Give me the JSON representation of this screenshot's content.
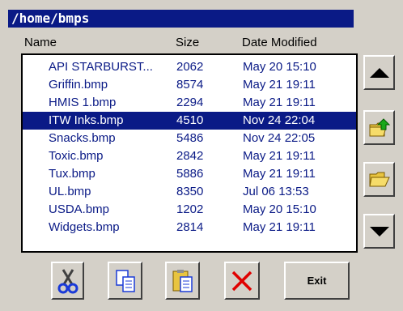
{
  "window": {
    "title": "/home/bmps"
  },
  "columns": {
    "name": "Name",
    "size": "Size",
    "date": "Date Modified"
  },
  "files": [
    {
      "name": "API STARBURST...",
      "size": "2062",
      "date": "May 20 15:10",
      "selected": false
    },
    {
      "name": "Griffin.bmp",
      "size": "8574",
      "date": "May 21 19:11",
      "selected": false
    },
    {
      "name": "HMIS 1.bmp",
      "size": "2294",
      "date": "May 21 19:11",
      "selected": false
    },
    {
      "name": "ITW Inks.bmp",
      "size": "4510",
      "date": "Nov 24 22:04",
      "selected": true
    },
    {
      "name": "Snacks.bmp",
      "size": "5486",
      "date": "Nov 24 22:05",
      "selected": false
    },
    {
      "name": "Toxic.bmp",
      "size": "2842",
      "date": "May 21 19:11",
      "selected": false
    },
    {
      "name": "Tux.bmp",
      "size": "5886",
      "date": "May 21 19:11",
      "selected": false
    },
    {
      "name": "UL.bmp",
      "size": "8350",
      "date": "Jul 06 13:53",
      "selected": false
    },
    {
      "name": "USDA.bmp",
      "size": "1202",
      "date": "May 20 15:10",
      "selected": false
    },
    {
      "name": "Widgets.bmp",
      "size": "2814",
      "date": "May 21 19:11",
      "selected": false
    }
  ],
  "side_buttons": [
    {
      "icon": "up-arrow-icon"
    },
    {
      "icon": "folder-up-icon"
    },
    {
      "icon": "open-folder-icon"
    },
    {
      "icon": "down-arrow-icon"
    }
  ],
  "toolbar": {
    "cut_icon": "scissors-icon",
    "copy_icon": "copy-icon",
    "paste_icon": "paste-icon",
    "delete_icon": "delete-x-icon",
    "exit_label": "Exit"
  },
  "colors": {
    "accent": "#0a1a86",
    "face": "#d4d0c8",
    "delete": "#e00000"
  }
}
